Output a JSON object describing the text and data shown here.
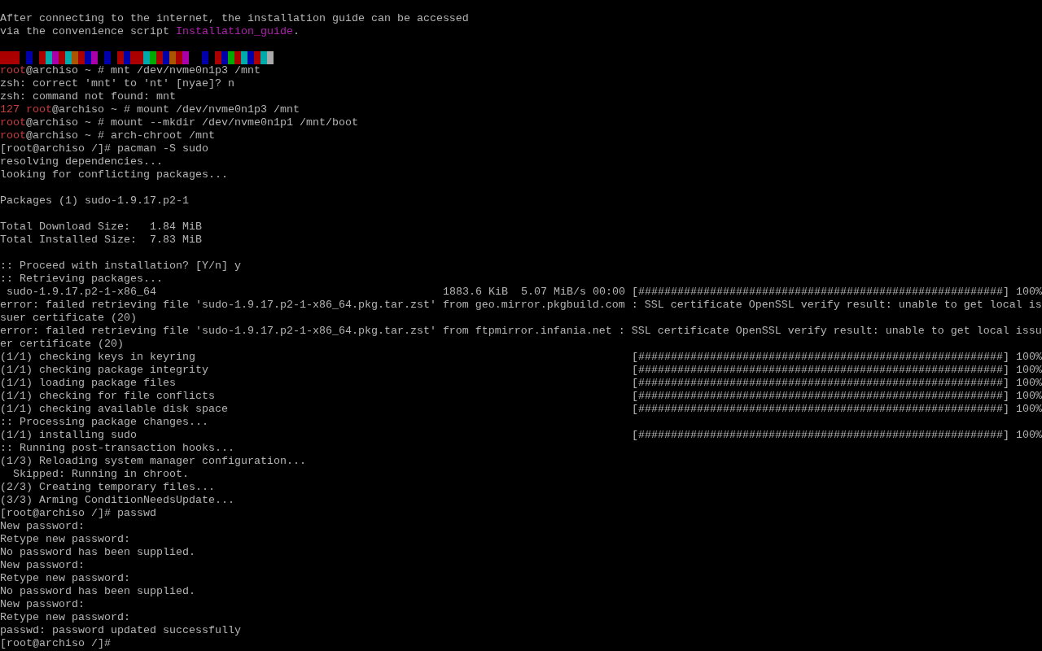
{
  "terminal": {
    "rows": [
      {
        "kind": "text",
        "segments": [
          {
            "kind": "plain",
            "text": "After connecting to the internet, the installation guide can be accessed"
          }
        ]
      },
      {
        "kind": "text",
        "segments": [
          {
            "kind": "plain",
            "text": "via the convenience script "
          },
          {
            "kind": "link",
            "text": "Installation_guide"
          },
          {
            "kind": "plain",
            "text": "."
          }
        ]
      },
      {
        "kind": "blank"
      },
      {
        "kind": "colors",
        "cells": [
          {
            "kind": "swatch",
            "color": "#aa0000"
          },
          {
            "kind": "swatch",
            "color": "#aa0000"
          },
          {
            "kind": "swatch",
            "color": "#aa0000"
          },
          {
            "kind": "gap"
          },
          {
            "kind": "swatch",
            "color": "#0000aa"
          },
          {
            "kind": "gap"
          },
          {
            "kind": "swatch",
            "color": "#aa0000"
          },
          {
            "kind": "swatch",
            "color": "#00aaaa"
          },
          {
            "kind": "swatch",
            "color": "#aa00aa"
          },
          {
            "kind": "swatch",
            "color": "#aa0000"
          },
          {
            "kind": "swatch",
            "color": "#00aaaa"
          },
          {
            "kind": "swatch",
            "color": "#aa5500"
          },
          {
            "kind": "swatch",
            "color": "#aa0000"
          },
          {
            "kind": "swatch",
            "color": "#0000aa"
          },
          {
            "kind": "swatch",
            "color": "#aa00aa"
          },
          {
            "kind": "gap"
          },
          {
            "kind": "swatch",
            "color": "#0000aa"
          },
          {
            "kind": "gap"
          },
          {
            "kind": "swatch",
            "color": "#aa0000"
          },
          {
            "kind": "swatch",
            "color": "#0000aa"
          },
          {
            "kind": "swatch",
            "color": "#aa0000"
          },
          {
            "kind": "swatch",
            "color": "#aa0000"
          },
          {
            "kind": "swatch",
            "color": "#00aaaa"
          },
          {
            "kind": "swatch",
            "color": "#00aa00"
          },
          {
            "kind": "swatch",
            "color": "#aa0000"
          },
          {
            "kind": "swatch",
            "color": "#0000aa"
          },
          {
            "kind": "swatch",
            "color": "#aa5500"
          },
          {
            "kind": "swatch",
            "color": "#aa0000"
          },
          {
            "kind": "swatch",
            "color": "#aa00aa"
          },
          {
            "kind": "gap"
          },
          {
            "kind": "gap"
          },
          {
            "kind": "swatch",
            "color": "#0000aa"
          },
          {
            "kind": "gap"
          },
          {
            "kind": "swatch",
            "color": "#aa0000"
          },
          {
            "kind": "swatch",
            "color": "#0000aa"
          },
          {
            "kind": "swatch",
            "color": "#00aa00"
          },
          {
            "kind": "swatch",
            "color": "#aa0000"
          },
          {
            "kind": "swatch",
            "color": "#00aaaa"
          },
          {
            "kind": "swatch",
            "color": "#0000aa"
          },
          {
            "kind": "swatch",
            "color": "#aa0000"
          },
          {
            "kind": "swatch",
            "color": "#00aaaa"
          },
          {
            "kind": "swatch",
            "color": "#aaaaaa"
          }
        ]
      },
      {
        "kind": "text",
        "segments": [
          {
            "kind": "user",
            "text": "root"
          },
          {
            "kind": "plain",
            "text": "@archiso ~ # mnt /dev/nvme0n1p3 /mnt"
          }
        ]
      },
      {
        "kind": "text",
        "segments": [
          {
            "kind": "plain",
            "text": "zsh: correct 'mnt' to 'nt' [nyae]? n"
          }
        ]
      },
      {
        "kind": "text",
        "segments": [
          {
            "kind": "plain",
            "text": "zsh: command not found: mnt"
          }
        ]
      },
      {
        "kind": "text",
        "segments": [
          {
            "kind": "status",
            "text": "127"
          },
          {
            "kind": "user",
            "text": "root"
          },
          {
            "kind": "plain",
            "text": "@archiso ~ # mount /dev/nvme0n1p3 /mnt"
          }
        ]
      },
      {
        "kind": "text",
        "segments": [
          {
            "kind": "user",
            "text": "root"
          },
          {
            "kind": "plain",
            "text": "@archiso ~ # mount --mkdir /dev/nvme0n1p1 /mnt/boot"
          }
        ]
      },
      {
        "kind": "text",
        "segments": [
          {
            "kind": "user",
            "text": "root"
          },
          {
            "kind": "plain",
            "text": "@archiso ~ # arch-chroot /mnt"
          }
        ]
      },
      {
        "kind": "text",
        "segments": [
          {
            "kind": "plain",
            "text": "[root@archiso /]# pacman -S sudo"
          }
        ]
      },
      {
        "kind": "text",
        "segments": [
          {
            "kind": "plain",
            "text": "resolving dependencies..."
          }
        ]
      },
      {
        "kind": "text",
        "segments": [
          {
            "kind": "plain",
            "text": "looking for conflicting packages..."
          }
        ]
      },
      {
        "kind": "blank"
      },
      {
        "kind": "text",
        "segments": [
          {
            "kind": "plain",
            "text": "Packages (1) sudo-1.9.17.p2-1"
          }
        ]
      },
      {
        "kind": "blank"
      },
      {
        "kind": "text",
        "segments": [
          {
            "kind": "plain",
            "text": "Total Download Size:   1.84 MiB"
          }
        ]
      },
      {
        "kind": "text",
        "segments": [
          {
            "kind": "plain",
            "text": "Total Installed Size:  7.83 MiB"
          }
        ]
      },
      {
        "kind": "blank"
      },
      {
        "kind": "text",
        "segments": [
          {
            "kind": "plain",
            "text": ":: Proceed with installation? [Y/n] y"
          }
        ]
      },
      {
        "kind": "text",
        "segments": [
          {
            "kind": "plain",
            "text": ":: Retrieving packages..."
          }
        ]
      },
      {
        "kind": "progress",
        "label": " sudo-1.9.17.p2-1-x86_64",
        "stats": "1883.6 KiB  5.07 MiB/s 00:00",
        "bar": "[########################################################] 100%"
      },
      {
        "kind": "text",
        "segments": [
          {
            "kind": "plain",
            "text": "error: failed retrieving file 'sudo-1.9.17.p2-1-x86_64.pkg.tar.zst' from geo.mirror.pkgbuild.com : SSL certificate OpenSSL verify result: unable to get local is"
          }
        ]
      },
      {
        "kind": "text",
        "segments": [
          {
            "kind": "plain",
            "text": "suer certificate (20)"
          }
        ]
      },
      {
        "kind": "text",
        "segments": [
          {
            "kind": "plain",
            "text": "error: failed retrieving file 'sudo-1.9.17.p2-1-x86_64.pkg.tar.zst' from ftpmirror.infania.net : SSL certificate OpenSSL verify result: unable to get local issu"
          }
        ]
      },
      {
        "kind": "text",
        "segments": [
          {
            "kind": "plain",
            "text": "er certificate (20)"
          }
        ]
      },
      {
        "kind": "progress",
        "label": "(1/1) checking keys in keyring",
        "bar": "[########################################################] 100%"
      },
      {
        "kind": "progress",
        "label": "(1/1) checking package integrity",
        "bar": "[########################################################] 100%"
      },
      {
        "kind": "progress",
        "label": "(1/1) loading package files",
        "bar": "[########################################################] 100%"
      },
      {
        "kind": "progress",
        "label": "(1/1) checking for file conflicts",
        "bar": "[########################################################] 100%"
      },
      {
        "kind": "progress",
        "label": "(1/1) checking available disk space",
        "bar": "[########################################################] 100%"
      },
      {
        "kind": "text",
        "segments": [
          {
            "kind": "plain",
            "text": ":: Processing package changes..."
          }
        ]
      },
      {
        "kind": "progress",
        "label": "(1/1) installing sudo",
        "bar": "[########################################################] 100%"
      },
      {
        "kind": "text",
        "segments": [
          {
            "kind": "plain",
            "text": ":: Running post-transaction hooks..."
          }
        ]
      },
      {
        "kind": "text",
        "segments": [
          {
            "kind": "plain",
            "text": "(1/3) Reloading system manager configuration..."
          }
        ]
      },
      {
        "kind": "text",
        "segments": [
          {
            "kind": "plain",
            "text": "  Skipped: Running in chroot."
          }
        ]
      },
      {
        "kind": "text",
        "segments": [
          {
            "kind": "plain",
            "text": "(2/3) Creating temporary files..."
          }
        ]
      },
      {
        "kind": "text",
        "segments": [
          {
            "kind": "plain",
            "text": "(3/3) Arming ConditionNeedsUpdate..."
          }
        ]
      },
      {
        "kind": "text",
        "segments": [
          {
            "kind": "plain",
            "text": "[root@archiso /]# passwd"
          }
        ]
      },
      {
        "kind": "text",
        "segments": [
          {
            "kind": "plain",
            "text": "New password:"
          }
        ]
      },
      {
        "kind": "text",
        "segments": [
          {
            "kind": "plain",
            "text": "Retype new password:"
          }
        ]
      },
      {
        "kind": "text",
        "segments": [
          {
            "kind": "plain",
            "text": "No password has been supplied."
          }
        ]
      },
      {
        "kind": "text",
        "segments": [
          {
            "kind": "plain",
            "text": "New password:"
          }
        ]
      },
      {
        "kind": "text",
        "segments": [
          {
            "kind": "plain",
            "text": "Retype new password:"
          }
        ]
      },
      {
        "kind": "text",
        "segments": [
          {
            "kind": "plain",
            "text": "No password has been supplied."
          }
        ]
      },
      {
        "kind": "text",
        "segments": [
          {
            "kind": "plain",
            "text": "New password:"
          }
        ]
      },
      {
        "kind": "text",
        "segments": [
          {
            "kind": "plain",
            "text": "Retype new password:"
          }
        ]
      },
      {
        "kind": "text",
        "segments": [
          {
            "kind": "plain",
            "text": "passwd: password updated successfully"
          }
        ]
      },
      {
        "kind": "text",
        "segments": [
          {
            "kind": "plain",
            "text": "[root@archiso /]#"
          }
        ]
      }
    ]
  }
}
